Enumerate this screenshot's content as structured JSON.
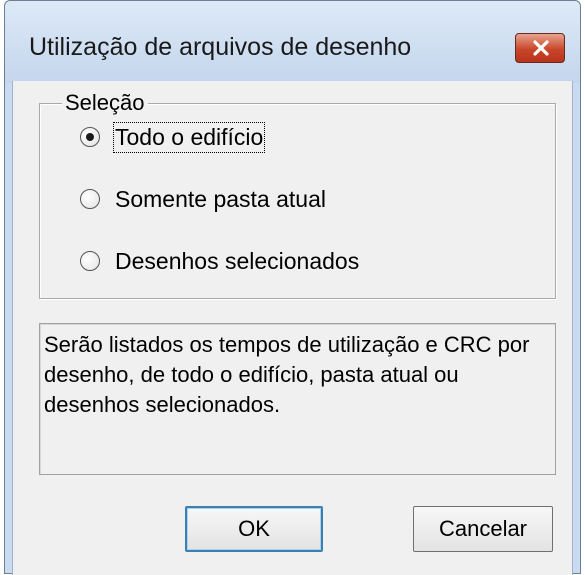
{
  "window": {
    "title": "Utilização de arquivos de desenho"
  },
  "selection_group": {
    "legend": "Seleção",
    "options": [
      {
        "label": "Todo o edifício",
        "checked": true
      },
      {
        "label": "Somente pasta atual",
        "checked": false
      },
      {
        "label": "Desenhos selecionados",
        "checked": false
      }
    ]
  },
  "description": "Serão listados os tempos de utilização e CRC por desenho, de todo o edifício, pasta atual ou desenhos selecionados.",
  "buttons": {
    "ok_label": "OK",
    "cancel_label": "Cancelar"
  },
  "icons": {
    "close": "close-icon"
  }
}
